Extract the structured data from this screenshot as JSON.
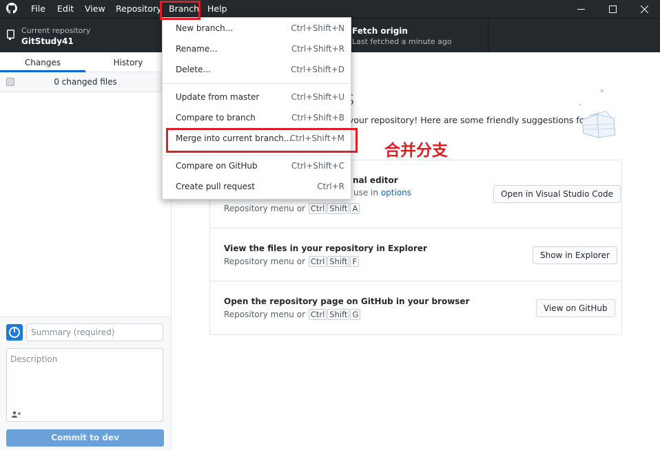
{
  "titlebar": {
    "menus": [
      "File",
      "Edit",
      "View",
      "Repository",
      "Branch",
      "Help"
    ]
  },
  "toolbar": {
    "current_repo_label": "Current repository",
    "current_repo_name": "GitStudy41",
    "fetch_title": "Fetch origin",
    "fetch_sub": "Last fetched a minute ago"
  },
  "sidebar": {
    "tabs": [
      "Changes",
      "History"
    ],
    "changed_files": "0 changed files",
    "summary_placeholder": "Summary (required)",
    "description_placeholder": "Description",
    "commit_prefix": "Commit to ",
    "commit_branch": "dev"
  },
  "main": {
    "title_fragment": "es",
    "subtitle_fragment": "your repository! Here are some friendly suggestions for",
    "cards": [
      {
        "title_fragment": "nal editor",
        "sub_fragment": "use in",
        "sub_link": "options",
        "shortcut_prefix": "Repository menu or",
        "keys": [
          "Ctrl",
          "Shift",
          "A"
        ],
        "button": "Open in Visual Studio Code"
      },
      {
        "title": "View the files in your repository in Explorer",
        "shortcut_prefix": "Repository menu or",
        "keys": [
          "Ctrl",
          "Shift",
          "F"
        ],
        "button": "Show in Explorer"
      },
      {
        "title": "Open the repository page on GitHub in your browser",
        "shortcut_prefix": "Repository menu or",
        "keys": [
          "Ctrl",
          "Shift",
          "G"
        ],
        "button": "View on GitHub"
      }
    ]
  },
  "branch_menu": {
    "items": [
      {
        "label": "New branch...",
        "shortcut": "Ctrl+Shift+N"
      },
      {
        "label": "Rename...",
        "shortcut": "Ctrl+Shift+R"
      },
      {
        "label": "Delete...",
        "shortcut": "Ctrl+Shift+D"
      },
      {
        "label": "Update from master",
        "shortcut": "Ctrl+Shift+U"
      },
      {
        "label": "Compare to branch",
        "shortcut": "Ctrl+Shift+B"
      },
      {
        "label": "Merge into current branch...",
        "shortcut": "Ctrl+Shift+M"
      },
      {
        "label": "Compare on GitHub",
        "shortcut": "Ctrl+Shift+C"
      },
      {
        "label": "Create pull request",
        "shortcut": "Ctrl+R"
      }
    ]
  },
  "annotation": {
    "text": "合并分支",
    "color": "#e01e25"
  },
  "colors": {
    "titlebar_bg": "#24292e",
    "accent_blue": "#0366d6",
    "commit_button": "#6aa1d8"
  }
}
